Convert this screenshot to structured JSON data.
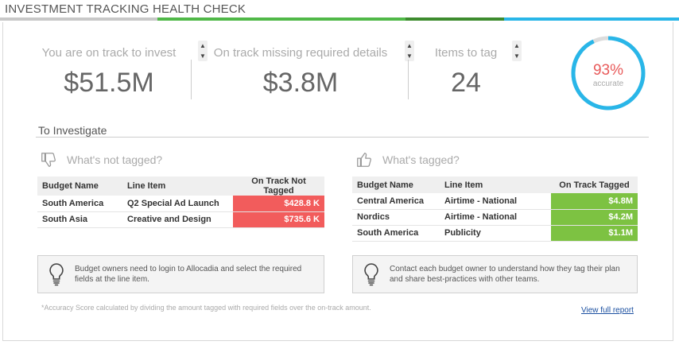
{
  "header": {
    "title": "INVESTMENT TRACKING HEALTH CHECK"
  },
  "stats": [
    {
      "label": "You are on track to invest",
      "value": "$51.5M"
    },
    {
      "label": "On track missing required details",
      "value": "$3.8M"
    },
    {
      "label": "Items to tag",
      "value": "24"
    }
  ],
  "gauge": {
    "percent_label": "93%",
    "sub_label": "accurate",
    "fraction": 0.93,
    "fill_color": "#29b6e8",
    "track_color": "#dcdcdc",
    "text_color": "#e85a5a"
  },
  "investigate": {
    "title": "To Investigate",
    "not_tagged": {
      "heading": "What's not tagged?",
      "columns": [
        "Budget Name",
        "Line Item",
        "On Track Not Tagged"
      ],
      "rows": [
        [
          "South America",
          "Q2 Special Ad Launch",
          "$428.8 K"
        ],
        [
          "South Asia",
          "Creative and Design",
          "$735.6 K"
        ]
      ],
      "tip": "Budget owners need to login to Allocadia and select the required fields at the line item."
    },
    "tagged": {
      "heading": "What's tagged?",
      "columns": [
        "Budget Name",
        "Line Item",
        "On Track Tagged"
      ],
      "rows": [
        [
          "Central America",
          "Airtime - National",
          "$4.8M"
        ],
        [
          "Nordics",
          "Airtime - National",
          "$4.2M"
        ],
        [
          "South America",
          "Publicity",
          "$1.1M"
        ]
      ],
      "tip": "Contact each budget owner to understand how they tag their plan and share best-practices with other teams."
    }
  },
  "footer": {
    "footnote": "*Accuracy Score calculated by dividing the amount tagged with required fields over the on-track amount.",
    "link": "View full report"
  },
  "colors": {
    "not_tagged_cell": "#f25c5c",
    "tagged_cell": "#7dc242"
  }
}
